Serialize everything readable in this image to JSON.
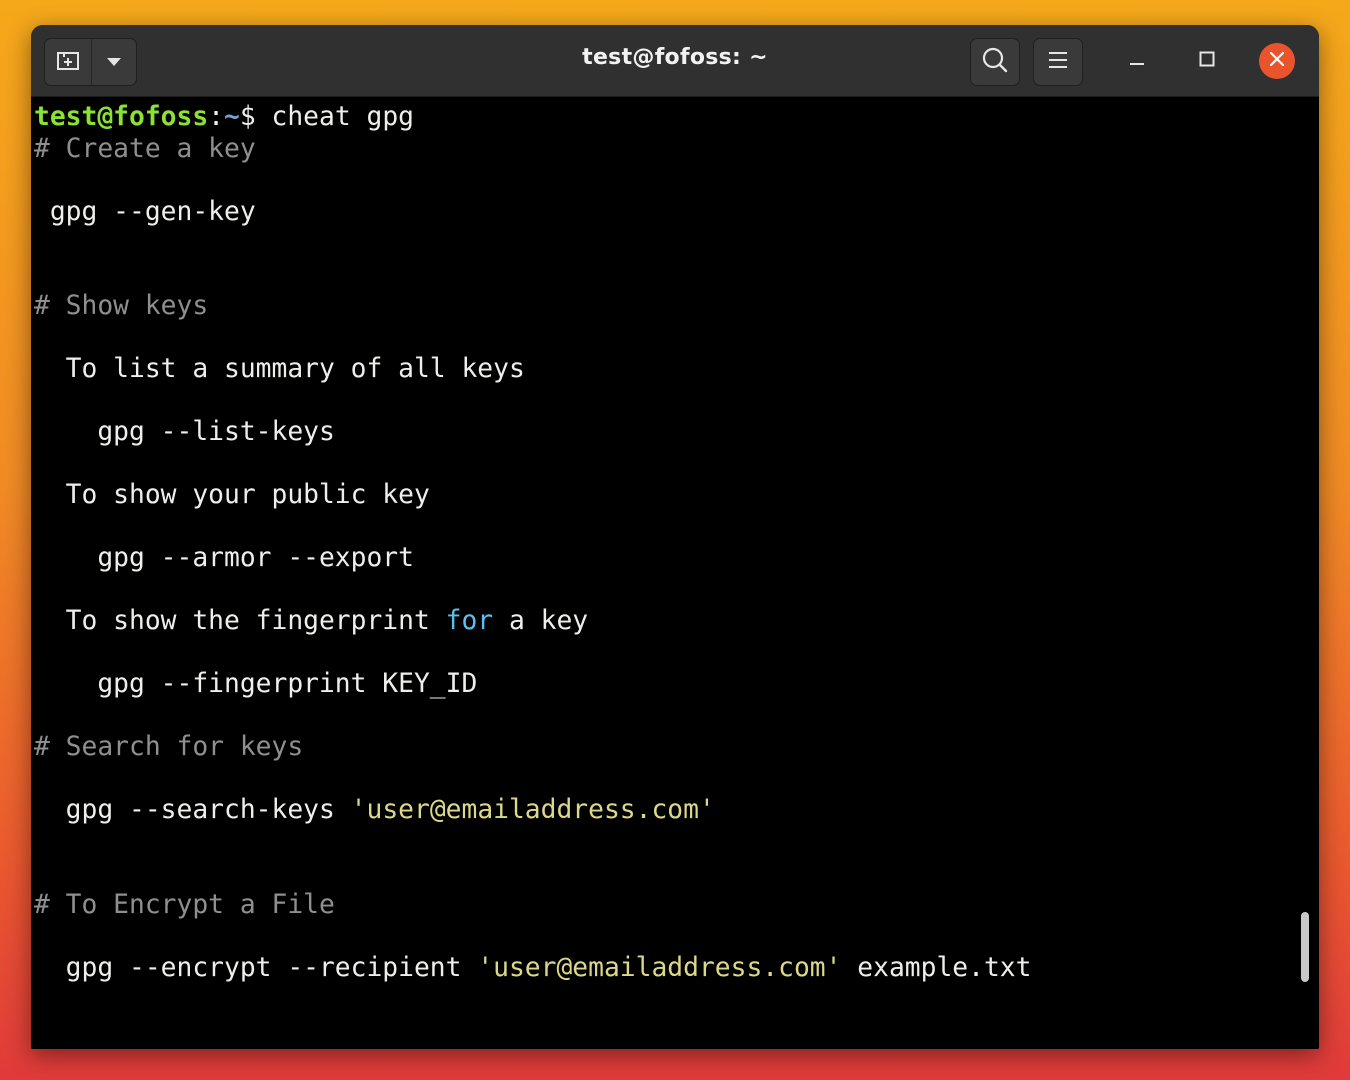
{
  "window": {
    "title": "test@fofoss: ~"
  },
  "titlebar": {
    "icons": [
      "new-tab-icon",
      "chevron-down-icon",
      "search-icon",
      "hamburger-menu-icon",
      "minimize-icon",
      "maximize-icon",
      "close-icon"
    ],
    "close_color": "#e9542d"
  },
  "terminal": {
    "prompt_user": "test@fofoss",
    "prompt_sep": ":",
    "prompt_path": "~",
    "prompt_dollar": "$ ",
    "command": "cheat gpg",
    "comment_create": "# Create a key",
    "cmd_gen_key": " gpg --gen-key",
    "comment_show": "# Show keys",
    "text_list_summary": "  To list a summary of all keys",
    "cmd_list_keys": "    gpg --list-keys",
    "text_show_public": "  To show your public key",
    "cmd_armor_export": "    gpg --armor --export",
    "text_fingerprint_pre": "  To show the fingerprint ",
    "text_fingerprint_kw": "for",
    "text_fingerprint_post": " a key",
    "cmd_fingerprint": "    gpg --fingerprint KEY_ID",
    "comment_search": "# Search for keys",
    "cmd_search_pre": "  gpg --search-keys ",
    "cmd_search_str": "'user@emailaddress.com'",
    "comment_encrypt": "# To Encrypt a File",
    "cmd_encrypt_pre": "  gpg --encrypt --recipient ",
    "cmd_encrypt_str": "'user@emailaddress.com'",
    "cmd_encrypt_post": " example.txt",
    "colors": {
      "prompt_user": "#8ae234",
      "prompt_path": "#729fcf",
      "comment": "#8f8f8f",
      "keyword": "#5fbfe8",
      "string": "#dcd88a",
      "foreground": "#eeeeec",
      "background": "#000000"
    }
  }
}
